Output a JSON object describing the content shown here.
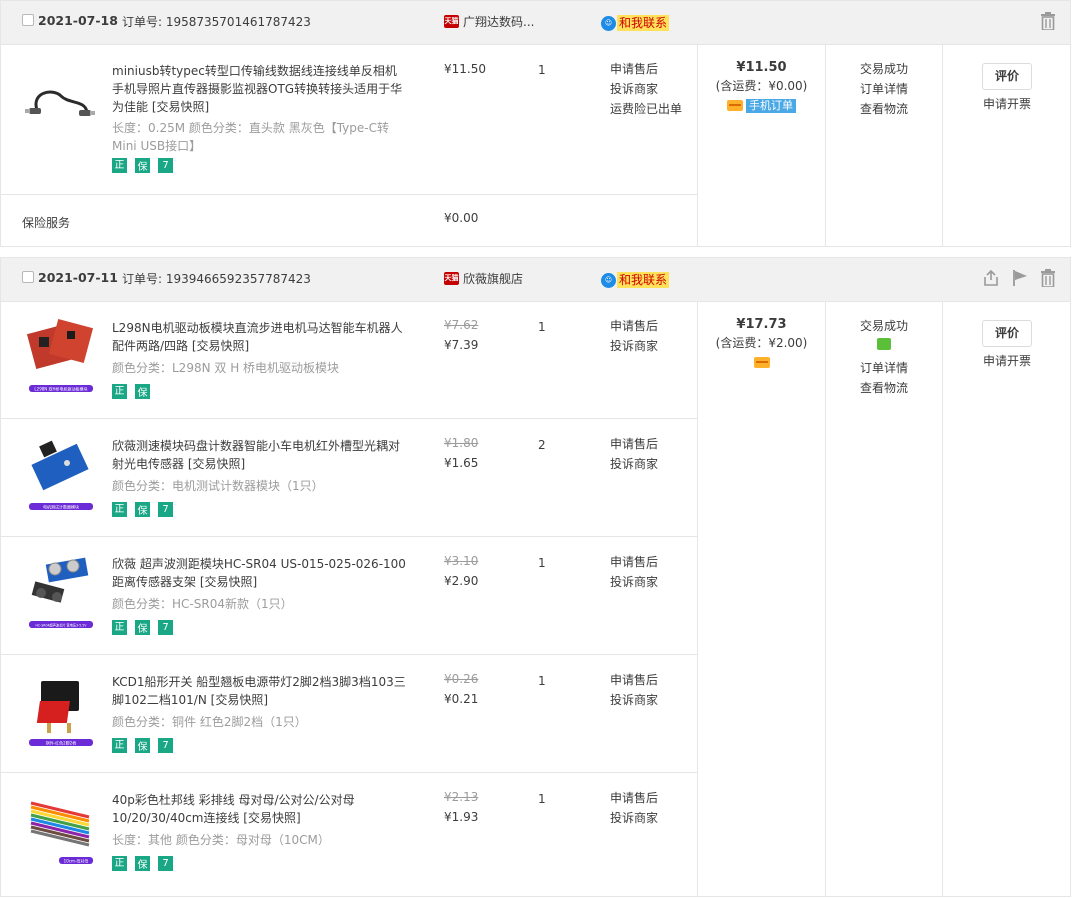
{
  "orders": [
    {
      "date": "2021-07-18",
      "order_no": "订单号: 1958735701461787423",
      "shop": "广翔达数码...",
      "shop_badge": "天猫",
      "contact": "和我联系",
      "total": "¥11.50",
      "shipping": "(含运费：¥0.00)",
      "mobile_tag": "手机订单",
      "status": [
        "交易成功",
        "订单详情",
        "查看物流"
      ],
      "review_button": "评价",
      "invoice_link": "申请开票",
      "items": [
        {
          "title": "miniusb转typec转型口传输线数据线连接线单反相机手机导照片直传器摄影监视器OTG转换转接头适用于华为佳能 [交易快照]",
          "spec": "长度：0.25M 颜色分类：直头款 黑灰色【Type-C转Mini USB接口】",
          "price": "¥11.50",
          "qty": "1",
          "ops": [
            "申请售后",
            "投诉商家",
            "运费险已出单"
          ]
        }
      ],
      "insurance_label": "保险服务",
      "insurance_price": "¥0.00"
    },
    {
      "date": "2021-07-11",
      "order_no": "订单号: 1939466592357787423",
      "shop": "欣薇旗舰店",
      "shop_badge": "天猫",
      "contact": "和我联系",
      "total": "¥17.73",
      "shipping": "(含运费：¥2.00)",
      "status": [
        "交易成功",
        "订单详情",
        "查看物流"
      ],
      "review_button": "评价",
      "invoice_link": "申请开票",
      "items": [
        {
          "title": "L298N电机驱动板模块直流步进电机马达智能车机器人配件两路/四路 [交易快照]",
          "spec": "颜色分类：L298N 双 H 桥电机驱动板模块",
          "price_old": "¥7.62",
          "price": "¥7.39",
          "qty": "1",
          "ops": [
            "申请售后",
            "投诉商家"
          ],
          "thumb_label": "L298N 双H桥电机驱动板模块"
        },
        {
          "title": "欣薇测速模块码盘计数器智能小车电机红外槽型光耦对射光电传感器 [交易快照]",
          "spec": "颜色分类：电机测试计数器模块（1只）",
          "price_old": "¥1.80",
          "price": "¥1.65",
          "qty": "2",
          "ops": [
            "申请售后",
            "投诉商家"
          ],
          "thumb_label": "电机测试计数器模块"
        },
        {
          "title": "欣薇 超声波测距模块HC-SR04 US-015-025-026-100距离传感器支架 [交易快照]",
          "spec": "颜色分类：HC-SR04新款（1只）",
          "price_old": "¥3.10",
          "price": "¥2.90",
          "qty": "1",
          "ops": [
            "申请售后",
            "投诉商家"
          ],
          "thumb_label": "HC-SR04超声波芯片 宽电压3-5.5V"
        },
        {
          "title": "KCD1船形开关 船型翘板电源带灯2脚2档3脚3档103三脚102二档101/N [交易快照]",
          "spec": "颜色分类：铜件 红色2脚2档（1只）",
          "price_old": "¥0.26",
          "price": "¥0.21",
          "qty": "1",
          "ops": [
            "申请售后",
            "投诉商家"
          ],
          "thumb_label": "铜件-红色2脚2档"
        },
        {
          "title": "40p彩色杜邦线 彩排线 母对母/公对公/公对母10/20/30/40cm连接线 [交易快照]",
          "spec": "长度：其他 颜色分类：母对母（10CM）",
          "price_old": "¥2.13",
          "price": "¥1.93",
          "qty": "1",
          "ops": [
            "申请售后",
            "投诉商家"
          ],
          "thumb_label": "10cm-母对母"
        }
      ]
    }
  ],
  "badges": [
    "正",
    "保",
    "7"
  ],
  "icons": {
    "delete": "trash-icon",
    "share": "share-icon",
    "flag": "flag-icon"
  }
}
